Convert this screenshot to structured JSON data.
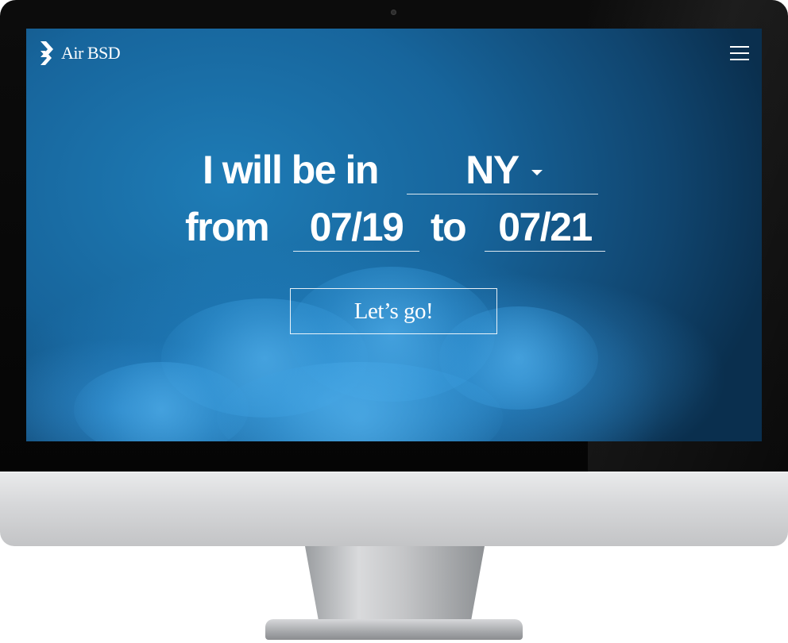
{
  "app": {
    "brand_name": "Air BSD",
    "logo_icon": "chevron-arrow-logo",
    "menu_icon": "hamburger-menu-icon"
  },
  "form": {
    "line1_prefix": "I will be in",
    "city_value": "NY",
    "line2_from": "from",
    "from_date": "07/19",
    "line2_to": "to",
    "to_date": "07/21",
    "submit_label": "Let’s go!"
  },
  "colors": {
    "sky_blue": "#17659c",
    "text": "#ffffff"
  }
}
